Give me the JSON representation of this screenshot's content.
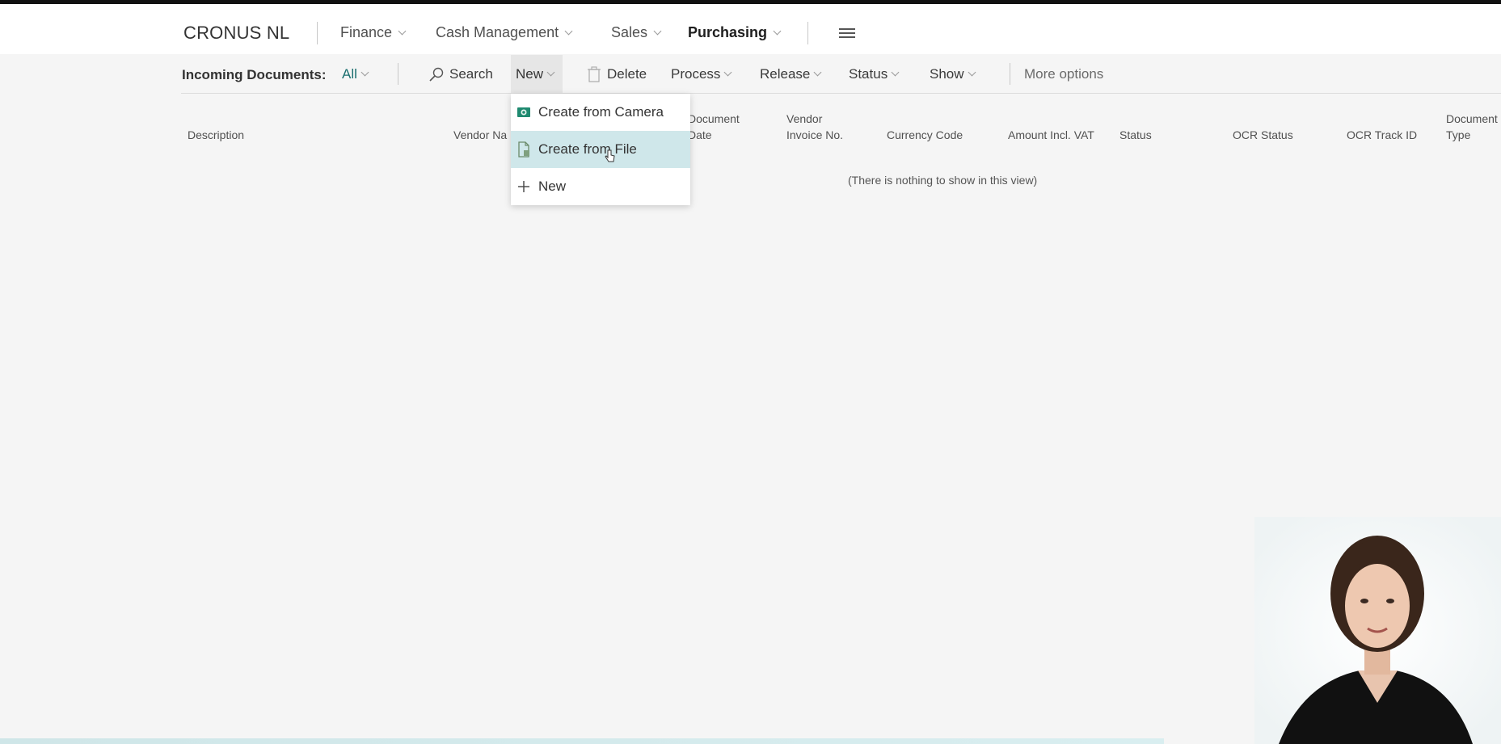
{
  "navbar": {
    "company": "CRONUS NL",
    "items": [
      {
        "label": "Finance"
      },
      {
        "label": "Cash Management"
      },
      {
        "label": "Sales"
      },
      {
        "label": "Purchasing"
      }
    ]
  },
  "actionbar": {
    "page_name": "Incoming Documents:",
    "filter": "All",
    "search": "Search",
    "new": "New",
    "delete": "Delete",
    "process": "Process",
    "release": "Release",
    "status": "Status",
    "show": "Show",
    "more_options": "More options"
  },
  "dropdown": {
    "items": [
      {
        "label": "Create from Camera",
        "icon": "camera-icon"
      },
      {
        "label": "Create from File",
        "icon": "file-icon"
      },
      {
        "label": "New",
        "icon": "plus-icon"
      }
    ]
  },
  "table": {
    "columns": [
      {
        "line1": "Description",
        "line2": ""
      },
      {
        "line1": "Vendor Na",
        "line2": ""
      },
      {
        "line1": "Document",
        "line2": "Date"
      },
      {
        "line1": "Vendor",
        "line2": "Invoice No."
      },
      {
        "line1": "Currency Code",
        "line2": ""
      },
      {
        "line1": "Amount Incl. VAT",
        "line2": ""
      },
      {
        "line1": "Status",
        "line2": ""
      },
      {
        "line1": "OCR Status",
        "line2": ""
      },
      {
        "line1": "OCR Track ID",
        "line2": ""
      },
      {
        "line1": "Document",
        "line2": "Type"
      }
    ],
    "empty_message": "(There is nothing to show in this view)"
  },
  "colors": {
    "accent": "#1b6f6f",
    "hover": "#cfe7ea",
    "background": "#f5f5f5"
  }
}
